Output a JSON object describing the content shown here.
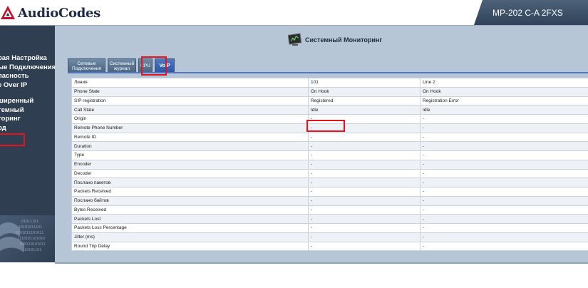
{
  "header": {
    "brand": "AudioCodes",
    "model": "MP-202 C-A 2FXS"
  },
  "sidebar": {
    "items": [
      "рая Настройка",
      "ые Подключения",
      "пасность",
      "e Over IP",
      "",
      "ширенный",
      "темный",
      "торинг",
      "од"
    ],
    "highlight_color": "#e4141e"
  },
  "page": {
    "title": "Системный Мониторинг",
    "title_icon": "monitor-icon"
  },
  "tabs": [
    {
      "label_line1": "Сетевые",
      "label_line2": "Подключения",
      "active": false
    },
    {
      "label_line1": "Системный",
      "label_line2": "журнал",
      "active": false
    },
    {
      "label_line1": "CPU",
      "label_line2": "",
      "active": false
    },
    {
      "label_line1": "VoIP",
      "label_line2": "",
      "active": true
    }
  ],
  "table": {
    "header": [
      "Линия",
      "101",
      "Line 2"
    ],
    "rows": [
      [
        "Phone State",
        "On Hook",
        "On Hook"
      ],
      [
        "SIP registration",
        "Registered",
        "Registration Error"
      ],
      [
        "Call State",
        "Idle",
        "Idle"
      ],
      [
        "Origin",
        "-",
        "-"
      ],
      [
        "Remote Phone Number",
        "-",
        "-"
      ],
      [
        "Remote ID",
        "-",
        "-"
      ],
      [
        "Duration",
        "-",
        "-"
      ],
      [
        "Type",
        "-",
        "-"
      ],
      [
        "Encoder",
        "-",
        "-"
      ],
      [
        "Decoder",
        "-",
        "-"
      ],
      [
        "Послано пакетов",
        "-",
        "-"
      ],
      [
        "Packets Received",
        "-",
        "-"
      ],
      [
        "Послано байтов",
        "-",
        "-"
      ],
      [
        "Bytes Received",
        "-",
        "-"
      ],
      [
        "Packets Lost",
        "-",
        "-"
      ],
      [
        "Packets Loss Percentage",
        "-",
        "-"
      ],
      [
        "Jitter (ms)",
        "-",
        "-"
      ],
      [
        "Round Trip Delay",
        "-",
        "-"
      ]
    ]
  },
  "colors": {
    "sidebar_bg": "#2f3e51",
    "content_bg": "#b7c6d7",
    "active_tab": "#2d57a8",
    "highlight": "#e4141e"
  }
}
